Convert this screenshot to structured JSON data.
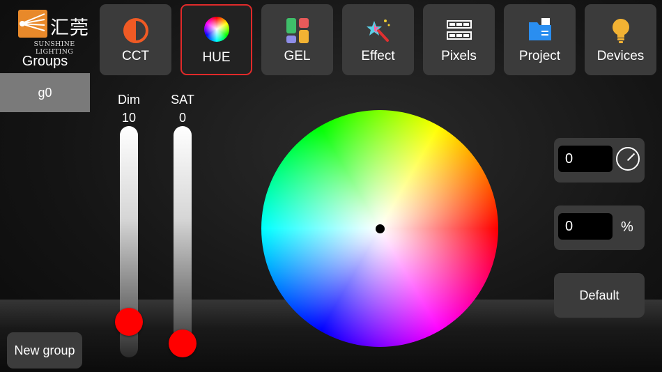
{
  "logo": {
    "brand": "汇莞",
    "subtitle": "SUNSHINE LIGHTING"
  },
  "sidebar": {
    "title": "Groups",
    "groups": [
      {
        "label": "g0",
        "selected": true
      }
    ],
    "new_group_label": "New group"
  },
  "tabs": [
    {
      "label": "CCT",
      "icon": "half-circle-icon",
      "active": false
    },
    {
      "label": "HUE",
      "icon": "color-ball-icon",
      "active": true
    },
    {
      "label": "GEL",
      "icon": "gel-grid-icon",
      "active": false
    },
    {
      "label": "Effect",
      "icon": "magic-wand-icon",
      "active": false
    },
    {
      "label": "Pixels",
      "icon": "pixels-icon",
      "active": false
    },
    {
      "label": "Project",
      "icon": "folder-icon",
      "active": false
    },
    {
      "label": "Devices",
      "icon": "bulb-icon",
      "active": false
    }
  ],
  "sliders": {
    "dim": {
      "label": "Dim",
      "value": "10",
      "level": 0.1
    },
    "sat": {
      "label": "SAT",
      "value": "0",
      "level": 0.0
    }
  },
  "hue_panel": {
    "hue_value": "0",
    "saturation_value": "0",
    "percent_unit": "%",
    "default_label": "Default"
  },
  "colors": {
    "accent_border": "#e12a2a",
    "knob": "#ff0000",
    "tab_bg": "#3b3b3b"
  }
}
